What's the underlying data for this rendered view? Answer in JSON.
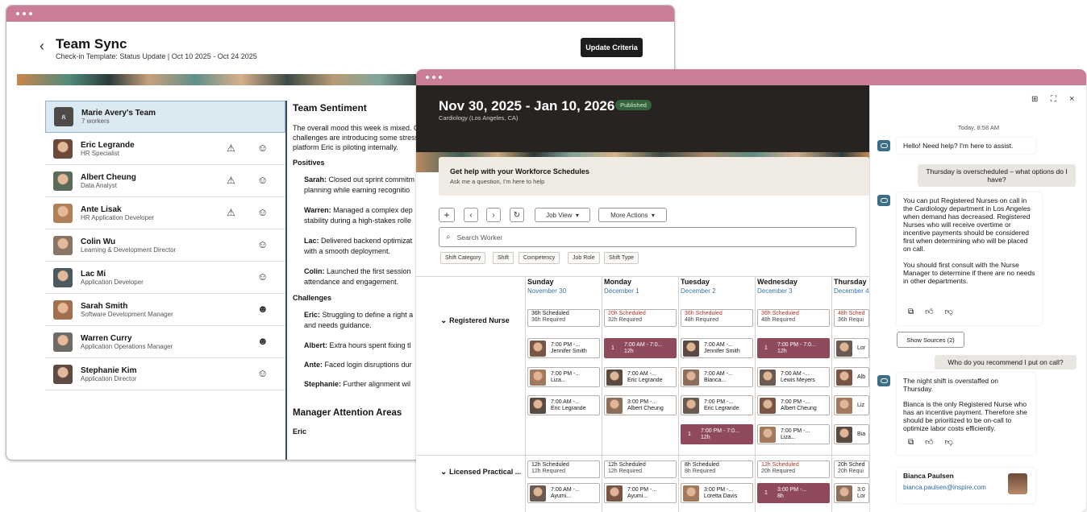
{
  "win1": {
    "title": "Team Sync",
    "subtitle": "Check-in Template: Status Update | Oct 10 2025 - Oct 24 2025",
    "update_button": "Update Criteria",
    "team": {
      "name": "Marie Avery's Team",
      "count": "7 workers"
    },
    "members": [
      {
        "name": "Eric Legrande",
        "role": "HR Specialist",
        "warning": true,
        "mood": "☺"
      },
      {
        "name": "Albert Cheung",
        "role": "Data Analyst",
        "warning": true,
        "mood": "☺"
      },
      {
        "name": "Ante Lisak",
        "role": "HR Application Developer",
        "warning": true,
        "mood": "☺"
      },
      {
        "name": "Colin Wu",
        "role": "Learning & Development Director",
        "warning": false,
        "mood": "☺"
      },
      {
        "name": "Lac Mi",
        "role": "Application Developer",
        "warning": false,
        "mood": "☺"
      },
      {
        "name": "Sarah Smith",
        "role": "Software Development Manager",
        "warning": false,
        "mood": "☻"
      },
      {
        "name": "Warren Curry",
        "role": "Application Operations Manager",
        "warning": false,
        "mood": "☻"
      },
      {
        "name": "Stephanie Kim",
        "role": "Application Director",
        "warning": false,
        "mood": "☺"
      }
    ],
    "sentiment": {
      "heading": "Team Sentiment",
      "intro": "The overall mood this week is mixed. O challenges are introducing some stress platform Eric is piloting internally.",
      "positives_heading": "Positives",
      "positives": [
        {
          "who": "Sarah:",
          "text": " Closed out sprint commitm planning while earning recognitio"
        },
        {
          "who": "Warren:",
          "text": " Managed a complex dep stability during a high-stakes rolle"
        },
        {
          "who": "Lac:",
          "text": " Delivered backend optimizat with a smooth deployment."
        },
        {
          "who": "Colin:",
          "text": " Launched the first session attendance and engagement."
        }
      ],
      "challenges_heading": "Challenges",
      "challenges": [
        {
          "who": "Eric:",
          "text": " Struggling to define a right a and needs guidance."
        },
        {
          "who": "Albert:",
          "text": " Extra hours spent fixing tl"
        },
        {
          "who": "Ante:",
          "text": " Faced login disruptions dur"
        },
        {
          "who": "Stephanie:",
          "text": " Further alignment wil"
        }
      ],
      "attention_heading": "Manager Attention Areas",
      "attention_first": "Eric"
    }
  },
  "win2": {
    "title": "Nov 30, 2025 - Jan 10, 2026",
    "badge": "Published",
    "location": "Cardiology (Los Angeles, CA)",
    "help_title": "Get help with your Workforce Schedules",
    "help_sub": "Ask me a question, I'm here to help",
    "toolbar": {
      "job_view": "Job View",
      "more_actions": "More Actions",
      "search_placeholder": "Search Worker"
    },
    "filters": [
      "Shift Category",
      "Shift",
      "Competency",
      "Job Role",
      "Shift Type"
    ],
    "days": [
      {
        "name": "Sunday",
        "date": "November 30"
      },
      {
        "name": "Monday",
        "date": "December 1"
      },
      {
        "name": "Tuesday",
        "date": "December 2"
      },
      {
        "name": "Wednesday",
        "date": "December 3"
      },
      {
        "name": "Thursday",
        "date": "December 4"
      }
    ],
    "groups": [
      {
        "name": "Registered Nurse",
        "summary": [
          {
            "s": "36h Scheduled",
            "r": "36h Required",
            "red": false
          },
          {
            "s": "20h Scheduled",
            "r": "32h Required",
            "red": true
          },
          {
            "s": "36h Scheduled",
            "r": "48h Required",
            "red": true
          },
          {
            "s": "36h Scheduled",
            "r": "48h Required",
            "red": true
          },
          {
            "s": "48h Sched",
            "r": "36h Requi",
            "red": true
          }
        ]
      },
      {
        "name": "Licensed Practical ...",
        "summary": [
          {
            "s": "12h Scheduled",
            "r": "12h Required",
            "red": false
          },
          {
            "s": "12h Scheduled",
            "r": "12h Required",
            "red": false
          },
          {
            "s": "8h Scheduled",
            "r": "8h Required",
            "red": false
          },
          {
            "s": "12h Scheduled",
            "r": "20h Required",
            "red": true
          },
          {
            "s": "20h Sched",
            "r": "20h Requi",
            "red": false
          }
        ]
      }
    ],
    "shifts": [
      [
        {
          "t": "7:00 PM -...",
          "n": "Jennifer Smith"
        },
        {
          "t": "7:00 PM -...",
          "n": "Liza..."
        },
        {
          "t": "7:00 AM -...",
          "n": "Eric Legrande"
        },
        null,
        {
          "t": "7:00 AM -...",
          "n": "Ayumi..."
        }
      ],
      [
        {
          "open": "1",
          "t": "7:00 AM - 7:0...",
          "n": "12h"
        },
        {
          "t": "7:00 AM -...",
          "n": "Eric Legrande"
        },
        {
          "t": "3:00 PM -...",
          "n": "Albert Cheung"
        },
        null,
        {
          "t": "7:00 PM -...",
          "n": "Ayumi..."
        }
      ],
      [
        {
          "t": "7:00 AM -...",
          "n": "Jennifer Smith"
        },
        {
          "t": "7:00 AM -...",
          "n": "Bianca..."
        },
        {
          "t": "7:00 PM -...",
          "n": "Eric Legrande"
        },
        {
          "open": "1",
          "t": "7:00 PM - 7:0...",
          "n": "12h"
        },
        {
          "t": "3:00 PM -...",
          "n": "Loretta Davis"
        }
      ],
      [
        {
          "open": "1",
          "t": "7:00 PM - 7:0...",
          "n": "12h"
        },
        {
          "t": "7:00 AM -...",
          "n": "Lewis Meyers"
        },
        {
          "t": "7:00 PM -...",
          "n": "Albert Cheung"
        },
        {
          "t": "7:00 PM -...",
          "n": "Liza..."
        },
        {
          "open": "1",
          "t": "3:00 PM -...",
          "n": "8h"
        }
      ],
      [
        {
          "t": "",
          "n": "Lor"
        },
        {
          "t": "",
          "n": "Alb"
        },
        {
          "t": "",
          "n": "Liz"
        },
        {
          "t": "",
          "n": "Bia"
        },
        {
          "t": "3:0",
          "n": "Lor"
        }
      ]
    ],
    "chat": {
      "timestamp": "Today, 8:58 AM",
      "m1": "Hello! Need help? I'm here to assist.",
      "q1": "Thursday is overscheduled – what options do I have?",
      "a1p1": "You can put Registered Nurses on call in the Cardiology department in Los Angeles when demand has decreased. Registered Nurses who will receive overtime or incentive payments should be considered first when determining who will be placed on call.",
      "a1p2": "You should first consult with the Nurse Manager to determine if there are no needs in other departments.",
      "sources": "Show Sources (2)",
      "q2": "Who do you recommend I put on call?",
      "a2p1": "The night shift is overstaffed on Thursday.",
      "a2p2": "Bianca is the only Registered Nurse who has an incentive payment. Therefore she should be prioritized to be on-call to optimize labor costs efficiently.",
      "card_name": "Bianca Paulsen",
      "card_email": "bianca.paulsen@inspire.com"
    }
  }
}
